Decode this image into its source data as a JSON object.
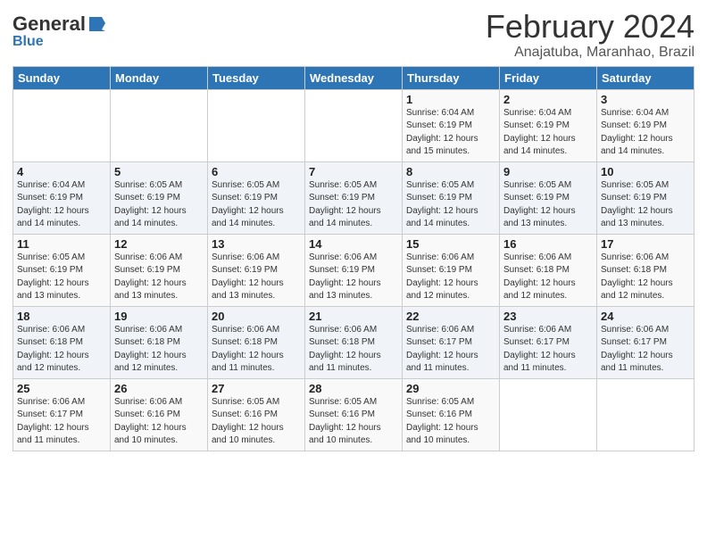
{
  "header": {
    "logo_general": "General",
    "logo_blue": "Blue",
    "logo_icon": "▶",
    "title": "February 2024",
    "subtitle": "Anajatuba, Maranhao, Brazil"
  },
  "days_of_week": [
    "Sunday",
    "Monday",
    "Tuesday",
    "Wednesday",
    "Thursday",
    "Friday",
    "Saturday"
  ],
  "weeks": [
    [
      {
        "day": "",
        "info": ""
      },
      {
        "day": "",
        "info": ""
      },
      {
        "day": "",
        "info": ""
      },
      {
        "day": "",
        "info": ""
      },
      {
        "day": "1",
        "info": "Sunrise: 6:04 AM\nSunset: 6:19 PM\nDaylight: 12 hours\nand 15 minutes."
      },
      {
        "day": "2",
        "info": "Sunrise: 6:04 AM\nSunset: 6:19 PM\nDaylight: 12 hours\nand 14 minutes."
      },
      {
        "day": "3",
        "info": "Sunrise: 6:04 AM\nSunset: 6:19 PM\nDaylight: 12 hours\nand 14 minutes."
      }
    ],
    [
      {
        "day": "4",
        "info": "Sunrise: 6:04 AM\nSunset: 6:19 PM\nDaylight: 12 hours\nand 14 minutes."
      },
      {
        "day": "5",
        "info": "Sunrise: 6:05 AM\nSunset: 6:19 PM\nDaylight: 12 hours\nand 14 minutes."
      },
      {
        "day": "6",
        "info": "Sunrise: 6:05 AM\nSunset: 6:19 PM\nDaylight: 12 hours\nand 14 minutes."
      },
      {
        "day": "7",
        "info": "Sunrise: 6:05 AM\nSunset: 6:19 PM\nDaylight: 12 hours\nand 14 minutes."
      },
      {
        "day": "8",
        "info": "Sunrise: 6:05 AM\nSunset: 6:19 PM\nDaylight: 12 hours\nand 14 minutes."
      },
      {
        "day": "9",
        "info": "Sunrise: 6:05 AM\nSunset: 6:19 PM\nDaylight: 12 hours\nand 13 minutes."
      },
      {
        "day": "10",
        "info": "Sunrise: 6:05 AM\nSunset: 6:19 PM\nDaylight: 12 hours\nand 13 minutes."
      }
    ],
    [
      {
        "day": "11",
        "info": "Sunrise: 6:05 AM\nSunset: 6:19 PM\nDaylight: 12 hours\nand 13 minutes."
      },
      {
        "day": "12",
        "info": "Sunrise: 6:06 AM\nSunset: 6:19 PM\nDaylight: 12 hours\nand 13 minutes."
      },
      {
        "day": "13",
        "info": "Sunrise: 6:06 AM\nSunset: 6:19 PM\nDaylight: 12 hours\nand 13 minutes."
      },
      {
        "day": "14",
        "info": "Sunrise: 6:06 AM\nSunset: 6:19 PM\nDaylight: 12 hours\nand 13 minutes."
      },
      {
        "day": "15",
        "info": "Sunrise: 6:06 AM\nSunset: 6:19 PM\nDaylight: 12 hours\nand 12 minutes."
      },
      {
        "day": "16",
        "info": "Sunrise: 6:06 AM\nSunset: 6:18 PM\nDaylight: 12 hours\nand 12 minutes."
      },
      {
        "day": "17",
        "info": "Sunrise: 6:06 AM\nSunset: 6:18 PM\nDaylight: 12 hours\nand 12 minutes."
      }
    ],
    [
      {
        "day": "18",
        "info": "Sunrise: 6:06 AM\nSunset: 6:18 PM\nDaylight: 12 hours\nand 12 minutes."
      },
      {
        "day": "19",
        "info": "Sunrise: 6:06 AM\nSunset: 6:18 PM\nDaylight: 12 hours\nand 12 minutes."
      },
      {
        "day": "20",
        "info": "Sunrise: 6:06 AM\nSunset: 6:18 PM\nDaylight: 12 hours\nand 11 minutes."
      },
      {
        "day": "21",
        "info": "Sunrise: 6:06 AM\nSunset: 6:18 PM\nDaylight: 12 hours\nand 11 minutes."
      },
      {
        "day": "22",
        "info": "Sunrise: 6:06 AM\nSunset: 6:17 PM\nDaylight: 12 hours\nand 11 minutes."
      },
      {
        "day": "23",
        "info": "Sunrise: 6:06 AM\nSunset: 6:17 PM\nDaylight: 12 hours\nand 11 minutes."
      },
      {
        "day": "24",
        "info": "Sunrise: 6:06 AM\nSunset: 6:17 PM\nDaylight: 12 hours\nand 11 minutes."
      }
    ],
    [
      {
        "day": "25",
        "info": "Sunrise: 6:06 AM\nSunset: 6:17 PM\nDaylight: 12 hours\nand 11 minutes."
      },
      {
        "day": "26",
        "info": "Sunrise: 6:06 AM\nSunset: 6:16 PM\nDaylight: 12 hours\nand 10 minutes."
      },
      {
        "day": "27",
        "info": "Sunrise: 6:05 AM\nSunset: 6:16 PM\nDaylight: 12 hours\nand 10 minutes."
      },
      {
        "day": "28",
        "info": "Sunrise: 6:05 AM\nSunset: 6:16 PM\nDaylight: 12 hours\nand 10 minutes."
      },
      {
        "day": "29",
        "info": "Sunrise: 6:05 AM\nSunset: 6:16 PM\nDaylight: 12 hours\nand 10 minutes."
      },
      {
        "day": "",
        "info": ""
      },
      {
        "day": "",
        "info": ""
      }
    ]
  ]
}
